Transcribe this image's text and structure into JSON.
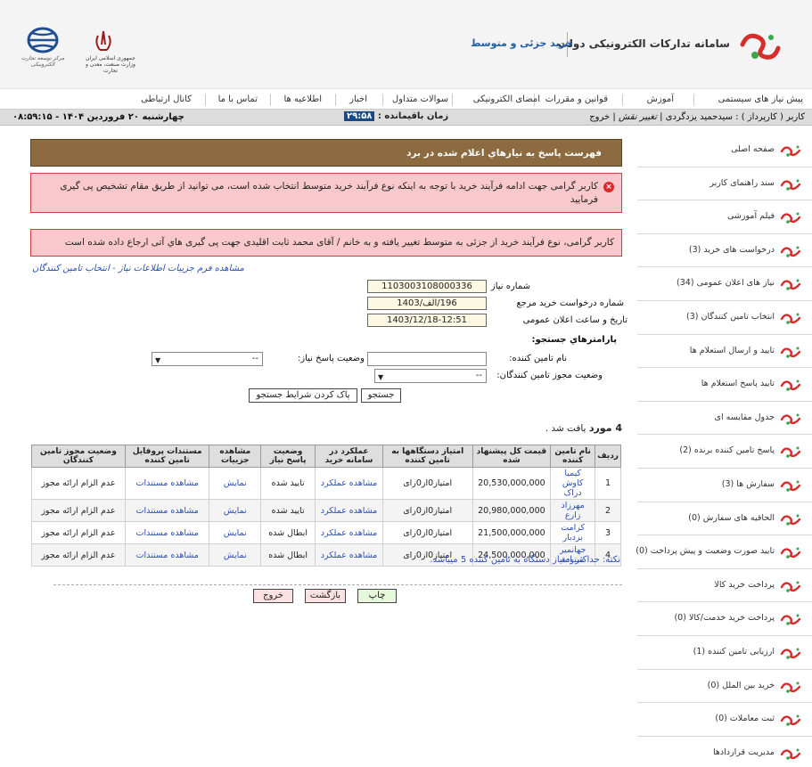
{
  "header": {
    "system_title": "سامانه تداركات الكترونيكی دولت",
    "system_subtitle": "خرید جزئی و متوسط",
    "emblem_text": "جمهوری اسلامی ایران وزارت صنعت، معدن و تجارت",
    "globe_text": "مرکز توسعه تجارت الکترونیکی"
  },
  "nav": {
    "items": [
      "پیش نیاز های سیستمی",
      "آموزش",
      "قوانین و مقررات",
      "امضای الکترونیکی",
      "سوالات متداول",
      "اخبار",
      "اطلاعیه ها",
      "تماس با ما",
      "کانال ارتباطی"
    ]
  },
  "status": {
    "user_prefix": "کاربر ( کارپرداز ) : سیدحمید یزدگردی |",
    "change_role": "تغییر نقش",
    "sep": "|",
    "logout": "خروج",
    "time_left_label": "زمان باقیمانده :",
    "timer": "۲۹:۵۸",
    "datetime": "چهارشنبه ۲۰ فروردین ۱۴۰۴ - ۰۸:۵۹:۱۵"
  },
  "sidebar": {
    "items": [
      "صفحه اصلی",
      "سند راهنمای کاربر",
      "فیلم آموزشی",
      "درخواست های خرید (3)",
      "نیاز های اعلان عمومی (34)",
      "انتخاب تامین کنندگان (3)",
      "تایید و ارسال استعلام ها",
      "تایید پاسخ استعلام ها",
      "جدول مقایسه ای",
      "پاسخ تامین کننده برنده (2)",
      "سفارش ها (3)",
      "الحاقیه های سفارش (0)",
      "تایید صورت وضعیت و پیش پرداخت (0)",
      "پرداخت خرید کالا",
      "پرداخت خرید خدمت/کالا (0)",
      "ارزیابی تامین کننده (1)",
      "خرید بین الملل  (0)",
      "ثبت معاملات  (0)",
      "مدیریت قراردادها"
    ]
  },
  "main": {
    "title": "فهرست پاسخ به نیازهاي اعلام شده در برد",
    "alert1": "کاربر گرامی جهت ادامه فرآیند خرید با توجه به اینکه نوع فرآیند خرید متوسط انتخاب شده است، می توانید از طریق مقام تشخیص پی گیری فرمایید",
    "alert2": "کاربر گرامی، نوع فرآیند خرید از جزئی به متوسط تغییر یافته و به خانم / آقای محمد ثابت اقلیدی جهت پی گیری هاي آتی ارجاع داده شده است",
    "details_link": "مشاهده فرم جزییات اطلاعات نیاز - انتخاب تامین کنندگان"
  },
  "form": {
    "need_number_label": "شماره نیاز",
    "need_number": "1103003108000336",
    "ref_request_label": "شماره درخواست خرید مرجع",
    "ref_request": "196/الف/1403",
    "announce_date_label": "تاریخ و ساعت اعلان عمومی",
    "announce_date": "1403/12/18-12:51",
    "search_params_label": "پارامترهاي جستجو:",
    "supplier_name_label": "نام تامین کننده:",
    "supplier_name_value": "",
    "response_status_label": "وضعیت پاسخ نیاز:",
    "response_status_value": "--",
    "license_status_label": "وضعیت مجوز تامین کنندگان:",
    "license_status_value": "--",
    "search_btn": "جستجو",
    "clear_btn": "پاک کردن شرایط جستجو"
  },
  "results": {
    "count": "4 مورد",
    "count_suffix": "یافت شد .",
    "headers": [
      "ردیف",
      "نام تامین کننده",
      "قیمت کل پیشنهاد شده",
      "امتیاز دستگاهها به تامین کننده",
      "عملکرد در سامانه خرید",
      "وضعیت پاسخ نیاز",
      "مشاهده جزییات",
      "مستندات پروفایل تامین کننده",
      "وضعیت مجوز تامین کنندگان"
    ],
    "rows": [
      {
        "idx": "1",
        "name": "کیمیا کاوش دراک",
        "price": "20,530,000,000",
        "score": "امتیاز0از0رای",
        "perf": "مشاهده عملکرد",
        "status": "تایید شده",
        "details": "نمایش",
        "docs": "مشاهده مستندات",
        "license": "عدم الزام ارائه مجوز"
      },
      {
        "idx": "2",
        "name": "مهرزاد زارع",
        "price": "20,980,000,000",
        "score": "امتیاز0از0رای",
        "perf": "مشاهده عملکرد",
        "status": "تایید شده",
        "details": "نمایش",
        "docs": "مشاهده مستندات",
        "license": "عدم الزام ارائه مجوز"
      },
      {
        "idx": "3",
        "name": "کرامت بردبار",
        "price": "21,500,000,000",
        "score": "امتیاز0از0رای",
        "perf": "مشاهده عملکرد",
        "status": "ابطال شده",
        "details": "نمایش",
        "docs": "مشاهده مستندات",
        "license": "عدم الزام ارائه مجوز"
      },
      {
        "idx": "4",
        "name": "جهانمیر ستوده",
        "price": "24,500,000,000",
        "score": "امتیاز0از0رای",
        "perf": "مشاهده عملکرد",
        "status": "ابطال شده",
        "details": "نمایش",
        "docs": "مشاهده مستندات",
        "license": "عدم الزام ارائه مجوز"
      }
    ],
    "note": "نکته: حداکثر امتیاز دستگاه به تامین کننده 5 میباشد."
  },
  "actions": {
    "print": "چاپ",
    "back": "بازگشت",
    "exit": "خروج"
  },
  "colors": {
    "title_bg": "#8b6b3f",
    "alert_bg": "#f9c8cc",
    "link": "#2b4fb5",
    "logo_red": "#d62c2c",
    "logo_green": "#3aa64a"
  }
}
